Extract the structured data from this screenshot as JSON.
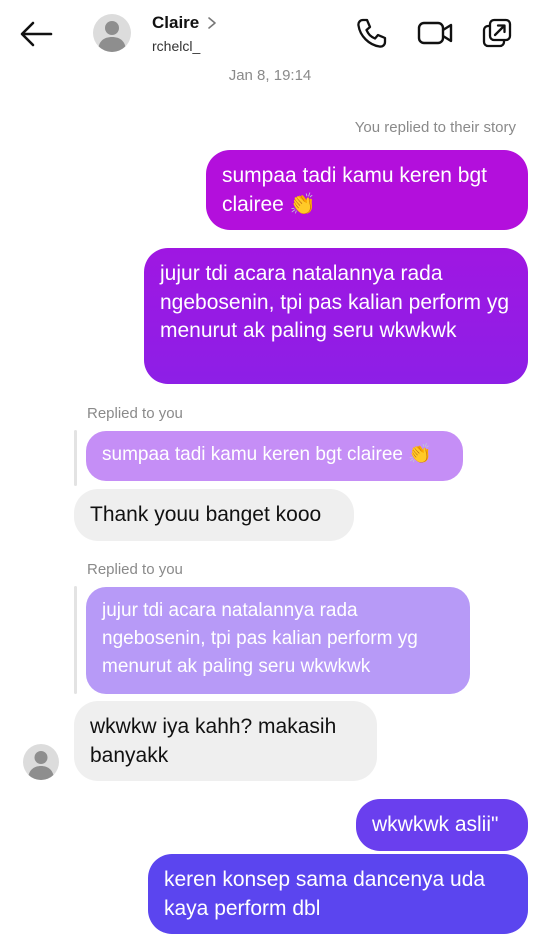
{
  "header": {
    "contact_name": "Claire",
    "username": "rchelcl_"
  },
  "thread": {
    "timestamp": "Jan 8, 19:14",
    "story_reply_label": "You replied to their story",
    "messages": [
      {
        "text": "sumpaa tadi kamu keren bgt clairee 👏"
      },
      {
        "text": "jujur tdi acara natalannya rada ngebosenin, tpi pas kalian perform yg menurut ak paling seru wkwkwk"
      },
      {
        "replied_label": "Replied to you",
        "quote": "sumpaa tadi kamu keren bgt clairee 👏",
        "text": "Thank youu banget kooo"
      },
      {
        "replied_label": "Replied to you",
        "quote": "jujur tdi acara natalannya rada ngebosenin, tpi pas kalian perform yg menurut ak paling seru wkwkwk",
        "text": "wkwkw iya kahh? makasih banyakk"
      },
      {
        "text": "wkwkwk aslii\""
      },
      {
        "text": "keren konsep sama dancenya uda kaya perform dbl"
      }
    ]
  },
  "colors": {
    "gradient_top": "#b30fdc",
    "gradient_mid": "#8d1fe6",
    "gradient_low": "#5b45ef",
    "quote_purple": "#c58ef6",
    "quote_lavender": "#b79af7",
    "incoming_bg": "#efefef"
  },
  "icons": [
    "back-arrow-icon",
    "avatar-icon",
    "chevron-right-icon",
    "phone-icon",
    "video-call-icon",
    "popout-icon"
  ]
}
